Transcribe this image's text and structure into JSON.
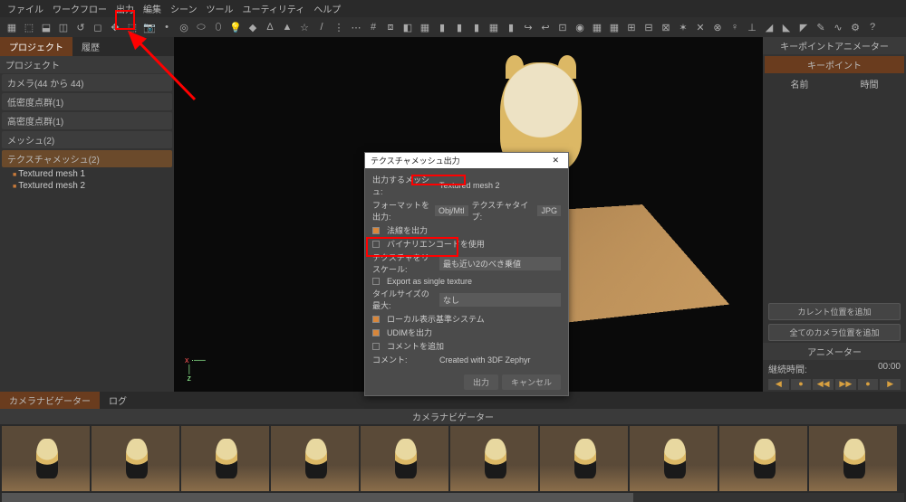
{
  "menu": {
    "items": [
      "ファイル",
      "ワークフロー",
      "出力",
      "編集",
      "シーン",
      "ツール",
      "ユーティリティ",
      "ヘルプ"
    ]
  },
  "toolbar": {
    "glyphs": [
      "▦",
      "⬚",
      "⬓",
      "◫",
      "↺",
      "◻",
      "✥",
      "⬚",
      "📷",
      "•",
      "◎",
      "⬭",
      "⬯",
      "💡",
      "◆",
      "Δ",
      "▲",
      "☆",
      "/",
      "⋮",
      "⋯",
      "#",
      "⧈",
      "◧",
      "▦",
      "▮",
      "▮",
      "▮",
      "▦",
      "▮",
      "↪",
      "↩",
      "⊡",
      "◉",
      "▦",
      "▦",
      "⊞",
      "⊟",
      "⊠",
      "✶",
      "✕",
      "⊗",
      "♀",
      "⊥",
      "◢",
      "◣",
      "◤",
      "✎",
      "∿",
      "⚙",
      "?"
    ]
  },
  "left": {
    "tabs": [
      "プロジェクト",
      "履歴"
    ],
    "section": "プロジェクト",
    "items": [
      "カメラ(44 から 44)",
      "低密度点群(1)",
      "高密度点群(1)",
      "メッシュ(2)",
      "テクスチャメッシュ(2)"
    ],
    "leaves": [
      "Textured mesh 1",
      "Textured mesh 2"
    ]
  },
  "dialog": {
    "title": "テクスチャメッシュ出力",
    "close": "✕",
    "rows": {
      "mesh_lbl": "出力するメッシュ:",
      "mesh_val": "Textured mesh 2",
      "fmt_lbl": "フォーマットを出力:",
      "fmt_val": "Obj/Mtl",
      "tex_lbl": "テクスチャタイプ:",
      "tex_val": "JPG",
      "normals": "法線を出力",
      "binary": "バイナリエンコードを使用",
      "rescale_lbl": "テクスチャをリスケール:",
      "rescale_val": "最も近い2のべき乗値",
      "single": "Export as single texture",
      "maxsize_lbl": "タイルサイズの最大:",
      "maxsize_val": "なし",
      "local": "ローカル表示基準システム",
      "udim": "UDIMを出力",
      "comment_chk": "コメントを追加",
      "comment_lbl": "コメント:",
      "comment_val": "Created with 3DF Zephyr"
    },
    "btn_ok": "出力",
    "btn_cancel": "キャンセル"
  },
  "right": {
    "title": "キーポイントアニメーター",
    "sub": "キーポイント",
    "col1": "名前",
    "col2": "時間",
    "btn1": "カレント位置を追加",
    "btn2": "全てのカメラ位置を追加",
    "anim_hdr": "アニメーター",
    "dur_lbl": "継続時間:",
    "dur_val": "00:00",
    "ctrls": [
      "◀",
      "●",
      "◀◀",
      "▶▶",
      "●",
      "▶"
    ]
  },
  "bottom": {
    "tabs": [
      "カメラナビゲーター",
      "ログ"
    ],
    "hdr": "カメラナビゲーター"
  },
  "axis": {
    "x": "x",
    "z": "z"
  }
}
